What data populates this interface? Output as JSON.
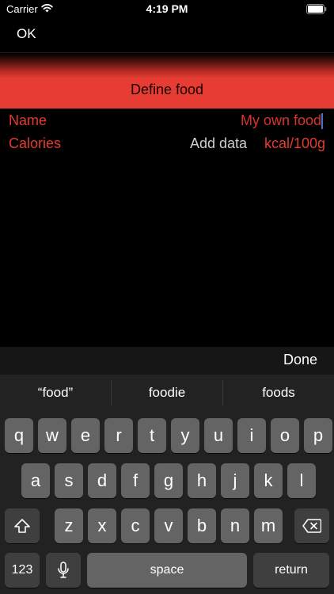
{
  "status": {
    "carrier": "Carrier",
    "time": "4:19 PM"
  },
  "nav": {
    "ok_label": "OK"
  },
  "header": {
    "title": "Define food"
  },
  "form": {
    "name_label": "Name",
    "name_value": "My own food",
    "calories_label": "Calories",
    "calories_placeholder": "Add data",
    "calories_unit": "kcal/100g"
  },
  "keyboard": {
    "done_label": "Done",
    "suggestions": [
      "“food”",
      "foodie",
      "foods"
    ],
    "row1": [
      "q",
      "w",
      "e",
      "r",
      "t",
      "y",
      "u",
      "i",
      "o",
      "p"
    ],
    "row2": [
      "a",
      "s",
      "d",
      "f",
      "g",
      "h",
      "j",
      "k",
      "l"
    ],
    "row3": [
      "z",
      "x",
      "c",
      "v",
      "b",
      "n",
      "m"
    ],
    "numbers_label": "123",
    "space_label": "space",
    "return_label": "return"
  },
  "colors": {
    "accent": "#e43b2e",
    "header_band": "#e63c33",
    "keyboard_bg": "#222222",
    "key_bg": "#646464"
  },
  "icons": {
    "wifi": "wifi-icon",
    "battery": "battery-icon",
    "shift": "shift-icon",
    "backspace": "backspace-icon",
    "mic": "microphone-icon"
  }
}
